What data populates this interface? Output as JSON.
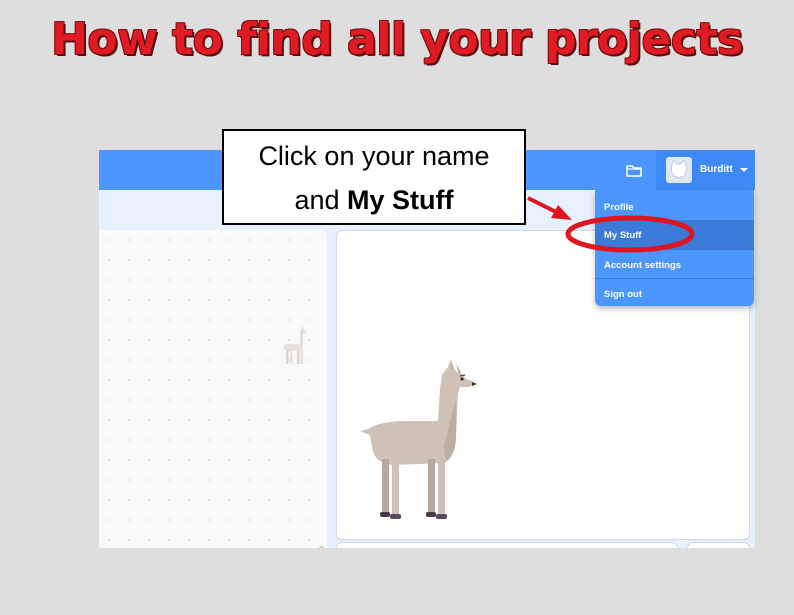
{
  "slide": {
    "title": "How to find all your projects"
  },
  "callout": {
    "line1": "Click on your name",
    "line2_prefix": "and ",
    "line2_bold": "My Stuff"
  },
  "menubar": {
    "folder_icon": "folder-icon",
    "account_name": "Burditt",
    "account_caret_icon": "caret-down-icon"
  },
  "account_menu": {
    "items": [
      {
        "label": "Profile"
      },
      {
        "label": "My Stuff",
        "highlighted": true
      },
      {
        "label": "Account settings"
      },
      {
        "label": "Sign out"
      }
    ]
  },
  "colors": {
    "title_red": "#e01b24",
    "menubar_blue": "#4c97ff",
    "highlight_ring": "#e0141e"
  }
}
